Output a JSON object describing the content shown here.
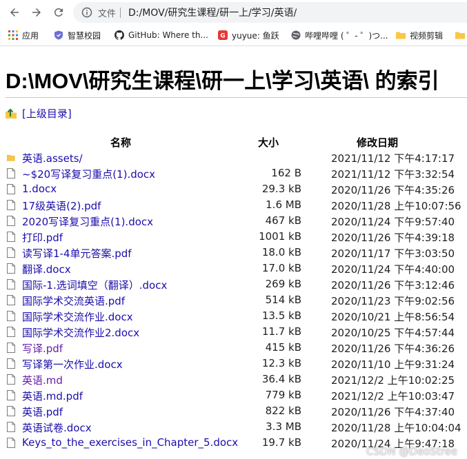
{
  "browser": {
    "site_label": "文件",
    "url": "D:/MOV/研究生课程/研一上/学习/英语/"
  },
  "bookmarks": [
    {
      "label": "应用",
      "icon": "apps-grid-icon",
      "color": "#4285f4"
    },
    {
      "label": "智慧校园",
      "icon": "shield-favicon-icon",
      "color": "#6b6fd3"
    },
    {
      "label": "GitHub: Where th...",
      "icon": "github-icon",
      "color": "#24292e"
    },
    {
      "label": "yuyue: 鱼跃",
      "icon": "red-favicon-icon",
      "color": "#e53935"
    },
    {
      "label": "哔哩哔哩 ( ゜- ゜)つ...",
      "icon": "globe-icon",
      "color": "#5f6368"
    },
    {
      "label": "视频剪辑",
      "icon": "folder-icon",
      "color": "#f9c646"
    }
  ],
  "page": {
    "title": "D:\\MOV\\研究生课程\\研一上\\学习\\英语\\ 的索引",
    "parent_link": "[上级目录]",
    "headers": {
      "name": "名称",
      "size": "大小",
      "modified": "修改日期"
    }
  },
  "files": [
    {
      "name": "英语.assets/",
      "size": "",
      "date": "2021/11/12 下午4:17:17",
      "type": "folder",
      "visited": false
    },
    {
      "name": "~$20写译复习重点(1).docx",
      "size": "162 B",
      "date": "2021/11/12 下午3:32:54",
      "type": "file",
      "visited": false
    },
    {
      "name": "1.docx",
      "size": "29.3 kB",
      "date": "2020/11/26 下午4:35:26",
      "type": "file",
      "visited": false
    },
    {
      "name": "17级英语(2).pdf",
      "size": "1.6 MB",
      "date": "2020/11/28 上午10:07:56",
      "type": "file",
      "visited": false
    },
    {
      "name": "2020写译复习重点(1).docx",
      "size": "467 kB",
      "date": "2020/11/24 下午9:57:40",
      "type": "file",
      "visited": false
    },
    {
      "name": "打印.pdf",
      "size": "1001 kB",
      "date": "2020/11/26 下午4:39:18",
      "type": "file",
      "visited": false
    },
    {
      "name": "读写译1-4单元答案.pdf",
      "size": "18.0 kB",
      "date": "2020/11/17 下午3:03:50",
      "type": "file",
      "visited": false
    },
    {
      "name": "翻译.docx",
      "size": "17.0 kB",
      "date": "2020/11/24 下午4:40:00",
      "type": "file",
      "visited": false
    },
    {
      "name": "国际-1.选词填空（翻译）.docx",
      "size": "269 kB",
      "date": "2020/11/26 下午3:12:46",
      "type": "file",
      "visited": false
    },
    {
      "name": "国际学术交流英语.pdf",
      "size": "514 kB",
      "date": "2020/11/23 下午9:02:56",
      "type": "file",
      "visited": false
    },
    {
      "name": "国际学术交流作业.docx",
      "size": "13.5 kB",
      "date": "2020/10/21 上午8:56:54",
      "type": "file",
      "visited": false
    },
    {
      "name": "国际学术交流作业2.docx",
      "size": "11.7 kB",
      "date": "2020/10/25 下午4:57:44",
      "type": "file",
      "visited": false
    },
    {
      "name": "写译.pdf",
      "size": "415 kB",
      "date": "2020/11/26 下午4:36:26",
      "type": "file",
      "visited": true
    },
    {
      "name": "写译第一次作业.docx",
      "size": "12.3 kB",
      "date": "2020/11/10 上午9:31:24",
      "type": "file",
      "visited": false
    },
    {
      "name": "英语.md",
      "size": "36.4 kB",
      "date": "2021/12/2 上午10:02:25",
      "type": "file",
      "visited": true
    },
    {
      "name": "英语.md.pdf",
      "size": "779 kB",
      "date": "2021/12/2 上午10:03:47",
      "type": "file",
      "visited": false
    },
    {
      "name": "英语.pdf",
      "size": "822 kB",
      "date": "2020/11/26 下午4:37:40",
      "type": "file",
      "visited": false
    },
    {
      "name": "英语试卷.docx",
      "size": "3.3 MB",
      "date": "2020/11/28 上午10:04:04",
      "type": "file",
      "visited": false
    },
    {
      "name": "Keys_to_the_exercises_in_Chapter_5.docx",
      "size": "19.7 kB",
      "date": "2020/11/24 上午9:47:18",
      "type": "file",
      "visited": false
    }
  ],
  "watermark": "CSDN @DeoStree",
  "colors": {
    "link": "#1a0dab",
    "visited_link": "#681da8",
    "folder": "#f9c646"
  }
}
